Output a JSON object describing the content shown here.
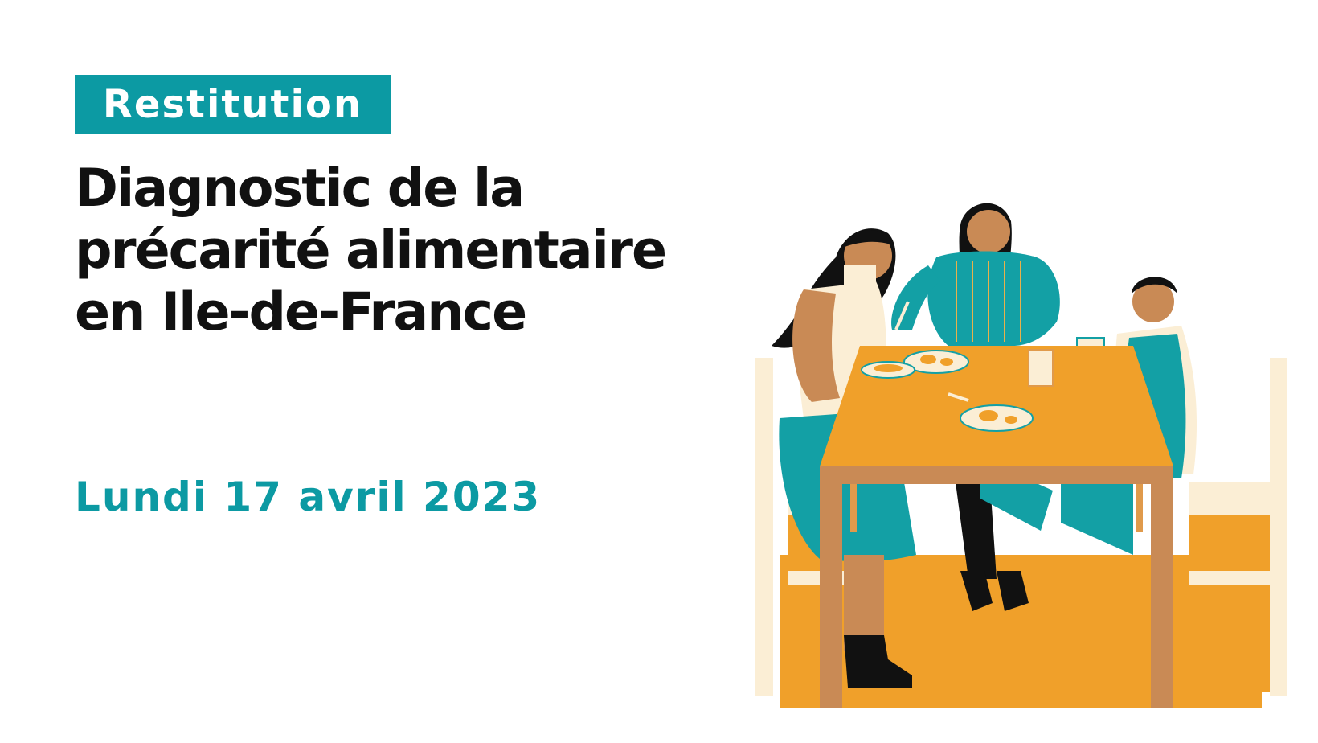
{
  "tag": "Restitution",
  "title_lines": [
    "Diagnostic de la",
    "précarité alimentaire",
    "en Ile-de-France"
  ],
  "date": "Lundi 17 avril 2023",
  "colors": {
    "teal": "#0c9aa3",
    "orange": "#f0a02a",
    "table_wood": "#c98a55",
    "cream": "#fbeed5",
    "text": "#111111"
  }
}
